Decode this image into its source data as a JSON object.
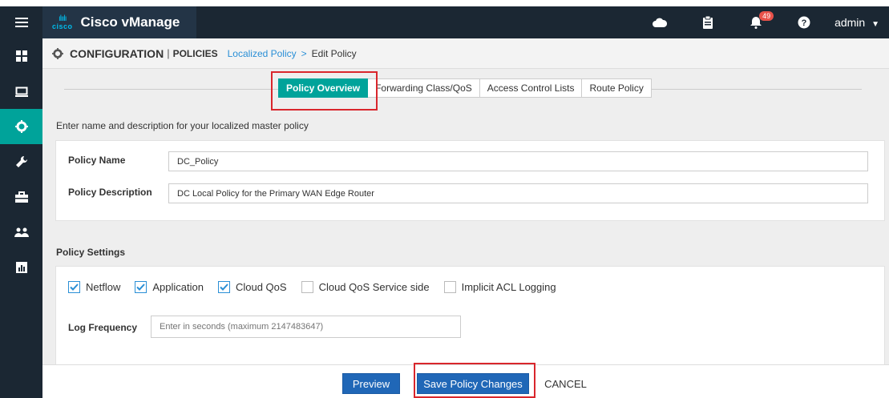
{
  "app": {
    "logo_bars": "ılıılı",
    "logo_word": "cisco",
    "title": "Cisco vManage",
    "notification_count": "49",
    "user": "admin"
  },
  "breadcrumb": {
    "title": "CONFIGURATION",
    "separator": "|",
    "section": "POLICIES",
    "parent": "Localized Policy",
    "arrow": ">",
    "current": "Edit Policy"
  },
  "tabs": [
    {
      "label": "Policy Overview",
      "active": true
    },
    {
      "label": "Forwarding Class/QoS",
      "active": false
    },
    {
      "label": "Access Control Lists",
      "active": false
    },
    {
      "label": "Route Policy",
      "active": false
    }
  ],
  "overview": {
    "heading": "Enter name and description for your localized master policy",
    "name_label": "Policy Name",
    "name_value": "DC_Policy",
    "description_label": "Policy Description",
    "description_value": "DC Local Policy for the Primary WAN Edge Router"
  },
  "settings": {
    "heading": "Policy Settings",
    "checkboxes": [
      {
        "label": "Netflow",
        "checked": true
      },
      {
        "label": "Application",
        "checked": true
      },
      {
        "label": "Cloud QoS",
        "checked": true
      },
      {
        "label": "Cloud QoS Service side",
        "checked": false
      },
      {
        "label": "Implicit ACL Logging",
        "checked": false
      }
    ],
    "log_frequency_label": "Log Frequency",
    "log_frequency_placeholder": "Enter in seconds (maximum 2147483647)"
  },
  "footer": {
    "preview_label": "Preview",
    "save_label": "Save Policy Changes",
    "cancel_label": "CANCEL"
  },
  "colors": {
    "nav_dark": "#1b2733",
    "accent_teal": "#00a39a",
    "primary_blue": "#2067b7",
    "link_blue": "#2a8fd6",
    "highlight_red": "#d9262c",
    "badge_red": "#e8524a"
  },
  "icons": {
    "top": [
      "menu-icon",
      "cloud-icon",
      "clipboard-icon",
      "bell-icon",
      "help-icon",
      "caret-down-icon"
    ],
    "sidebar": [
      "dashboard-icon",
      "monitor-icon",
      "gear-icon",
      "wrench-icon",
      "toolbox-icon",
      "users-icon",
      "analytics-icon"
    ]
  }
}
